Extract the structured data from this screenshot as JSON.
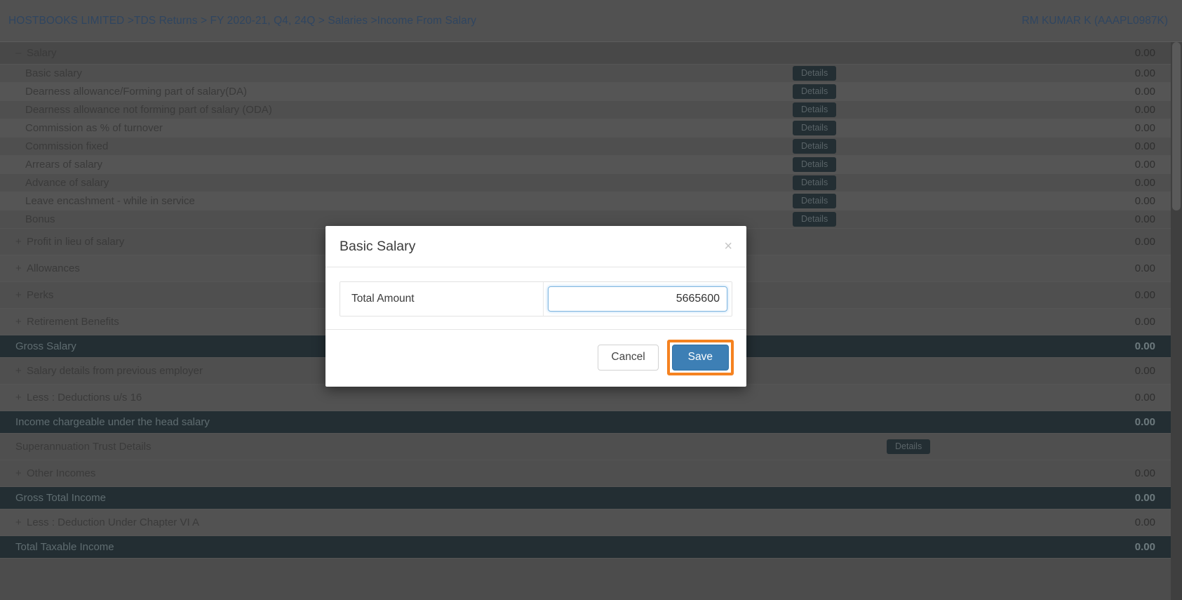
{
  "header": {
    "breadcrumb": [
      {
        "text": "HOSTBOOKS LIMITED",
        "link": true
      },
      {
        "text": ">",
        "sep": true
      },
      {
        "text": "TDS Returns",
        "link": true
      },
      {
        "text": ">",
        "sep": true
      },
      {
        "text": "FY 2020-21, Q4, 24Q",
        "link": true
      },
      {
        "text": ">",
        "sep": true
      },
      {
        "text": "Salaries",
        "link": true
      },
      {
        "text": ">",
        "sep": true
      },
      {
        "text": "Income From Salary",
        "link": false
      }
    ],
    "breadcrumb_text": "HOSTBOOKS LIMITED >TDS Returns > FY 2020-21, Q4, 24Q > Salaries >Income From Salary",
    "user": "RM KUMAR K (AAAPL0987K)"
  },
  "table": {
    "details_label": "Details",
    "rows": [
      {
        "kind": "group",
        "toggle": "–",
        "label": "Salary",
        "value": "0.00",
        "details": false
      },
      {
        "kind": "child",
        "label": "Basic salary",
        "value": "0.00",
        "details": true
      },
      {
        "kind": "child",
        "label": "Dearness allowance/Forming part of salary(DA)",
        "value": "0.00",
        "details": true
      },
      {
        "kind": "child",
        "label": "Dearness allowance not forming part of salary (ODA)",
        "value": "0.00",
        "details": true
      },
      {
        "kind": "child",
        "label": "Commission as % of turnover",
        "value": "0.00",
        "details": true
      },
      {
        "kind": "child",
        "label": "Commission fixed",
        "value": "0.00",
        "details": true
      },
      {
        "kind": "child",
        "label": "Arrears of salary",
        "value": "0.00",
        "details": true
      },
      {
        "kind": "child",
        "label": "Advance of salary",
        "value": "0.00",
        "details": true
      },
      {
        "kind": "child",
        "label": "Leave encashment - while in service",
        "value": "0.00",
        "details": true
      },
      {
        "kind": "child",
        "label": "Bonus",
        "value": "0.00",
        "details": true
      },
      {
        "kind": "section",
        "toggle": "+",
        "label": "Profit in lieu of salary",
        "value": "0.00",
        "details": false
      },
      {
        "kind": "section",
        "toggle": "+",
        "label": "Allowances",
        "value": "0.00",
        "details": false
      },
      {
        "kind": "section",
        "toggle": "+",
        "label": "Perks",
        "value": "0.00",
        "details": false
      },
      {
        "kind": "section",
        "toggle": "+",
        "label": "Retirement Benefits",
        "value": "0.00",
        "details": false
      },
      {
        "kind": "total",
        "label": "Gross Salary",
        "value": "0.00",
        "details": false
      },
      {
        "kind": "section",
        "toggle": "+",
        "label": "Salary details from previous employer",
        "value": "0.00",
        "details": false
      },
      {
        "kind": "section",
        "toggle": "+",
        "label": "Less : Deductions u/s 16",
        "value": "0.00",
        "details": false
      },
      {
        "kind": "total",
        "label": "Income chargeable under the head salary",
        "value": "0.00",
        "details": false
      },
      {
        "kind": "plain",
        "label": "Superannuation Trust Details",
        "value": "",
        "details": true,
        "details_far": true
      },
      {
        "kind": "section",
        "toggle": "+",
        "label": "Other Incomes",
        "value": "0.00",
        "details": false
      },
      {
        "kind": "total",
        "label": "Gross Total Income",
        "value": "0.00",
        "details": false
      },
      {
        "kind": "section",
        "toggle": "+",
        "label": "Less : Deduction Under Chapter VI A",
        "value": "0.00",
        "details": false
      },
      {
        "kind": "total",
        "label": "Total Taxable Income",
        "value": "0.00",
        "details": false
      }
    ]
  },
  "modal": {
    "title": "Basic Salary",
    "close_glyph": "×",
    "field_label": "Total Amount",
    "field_value": "5665600",
    "field_placeholder": "",
    "cancel_label": "Cancel",
    "save_label": "Save"
  },
  "colors": {
    "save_button": "#3d7fb5",
    "highlight_ring": "#f58220",
    "summary_row": "#232e33",
    "breadcrumb_link": "#2f4560"
  }
}
